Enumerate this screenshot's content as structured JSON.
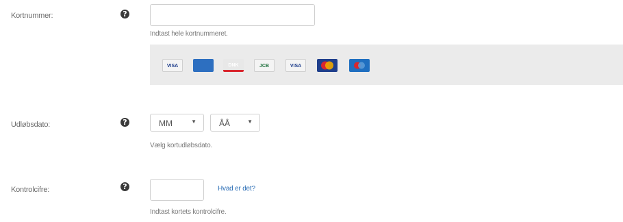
{
  "card_number": {
    "label": "Kortnummer:",
    "info_glyph": "?",
    "value": "",
    "hint": "Indtast hele kortnummeret.",
    "card_logos": [
      {
        "name": "visa",
        "text": "VISA",
        "bg": "#f4f4f4",
        "fg": "#1a3a8a",
        "stripe": "#f0a800"
      },
      {
        "name": "amex",
        "text": "",
        "bg": "#2d6fc0",
        "fg": "#ffffff",
        "stripe": ""
      },
      {
        "name": "dankort",
        "text": "DNK",
        "bg": "#e8e8e8",
        "fg": "#ffffff",
        "stripe": "#d9272e"
      },
      {
        "name": "jcb",
        "text": "JCB",
        "bg": "#f4f4f4",
        "fg": "#1a6e3a",
        "stripe": ""
      },
      {
        "name": "visa-electron",
        "text": "VISA",
        "bg": "#f4f4f4",
        "fg": "#1a3a8a",
        "stripe": "#5a9ad6"
      },
      {
        "name": "mastercard",
        "text": "",
        "bg": "#1f3f8c",
        "fg": "#ffffff",
        "stripe": ""
      },
      {
        "name": "maestro",
        "text": "",
        "bg": "#1f6fc0",
        "fg": "#ffffff",
        "stripe": ""
      }
    ]
  },
  "expiry": {
    "label": "Udløbsdato:",
    "info_glyph": "?",
    "month": {
      "selected": "MM"
    },
    "year": {
      "selected": "ÅÅ"
    },
    "arrow": "▼",
    "hint": "Vælg kortudløbsdato."
  },
  "cvc": {
    "label": "Kontrolcifre:",
    "info_glyph": "?",
    "value": "",
    "help_link": "Hvad er det?",
    "hint": "Indtast kortets kontrolcifre."
  }
}
